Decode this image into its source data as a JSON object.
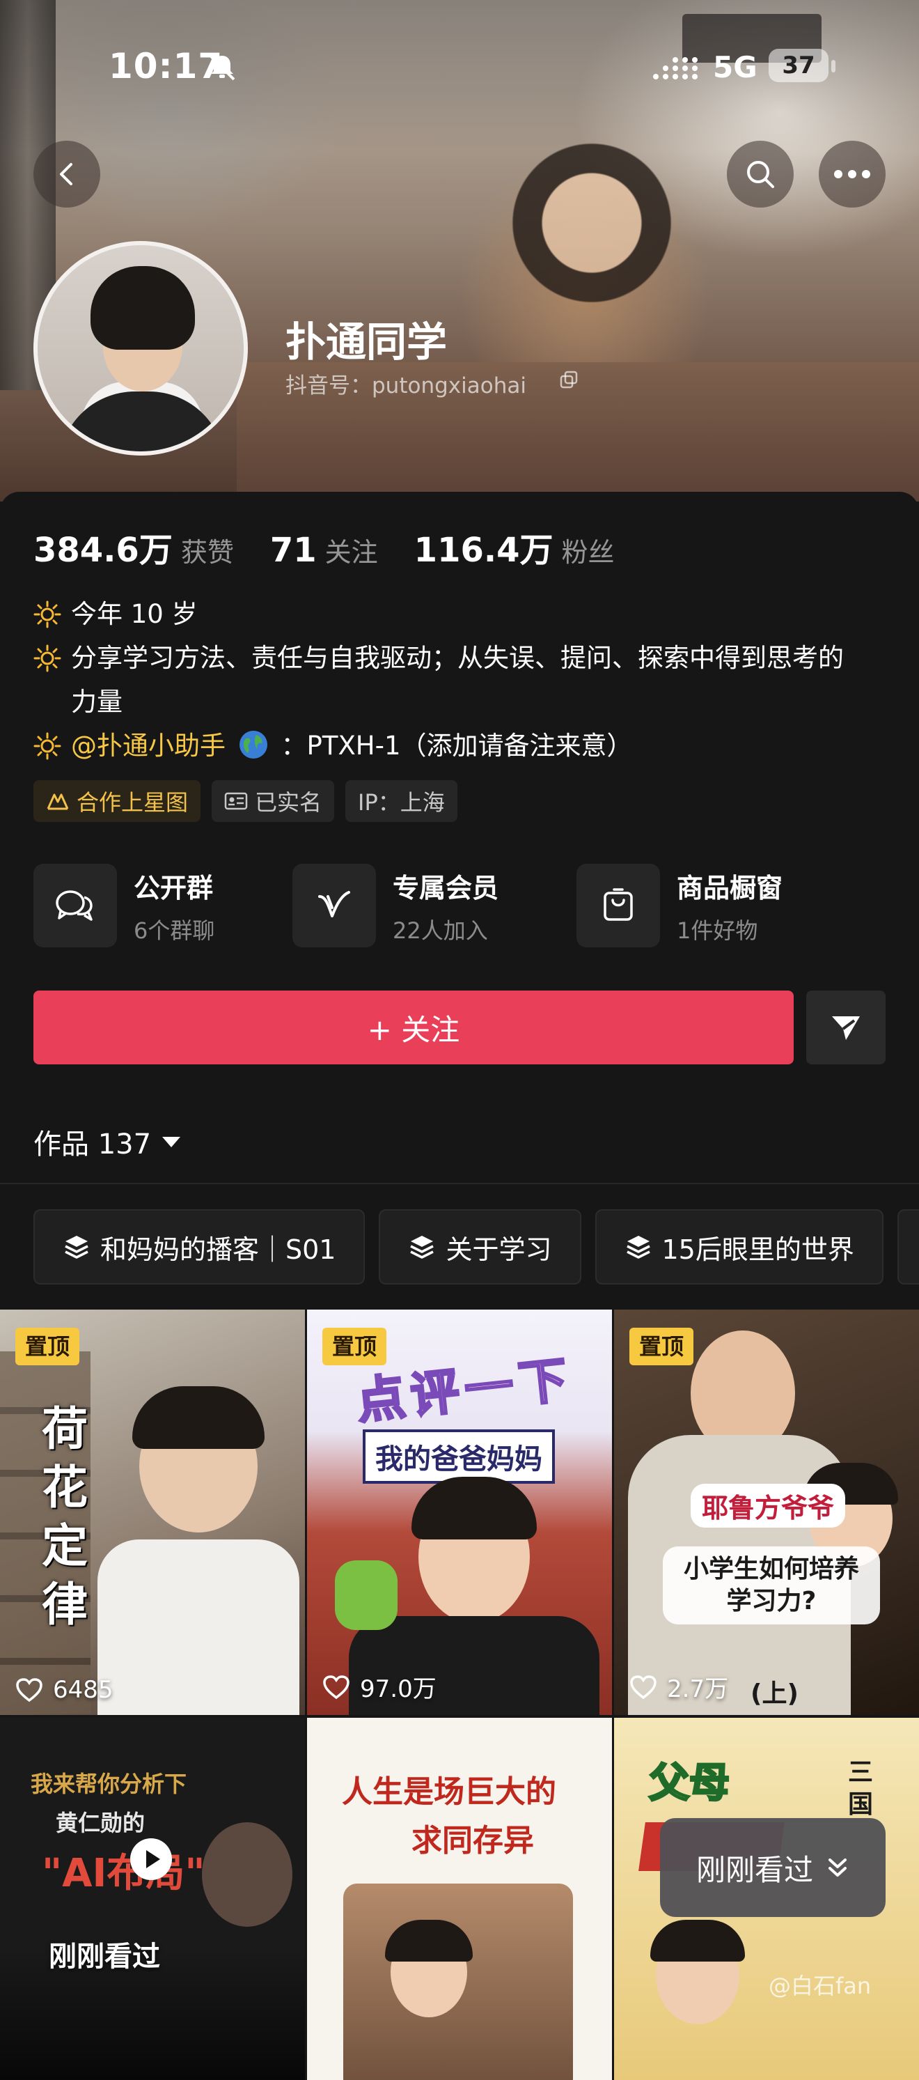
{
  "status_bar": {
    "time": "10:17",
    "network": "5G",
    "battery": "37"
  },
  "profile": {
    "name": "扑通同学",
    "douyin_id": "抖音号：putongxiaohai",
    "stats": [
      {
        "value": "384.6万",
        "label": "获赞"
      },
      {
        "value": "71",
        "label": "关注"
      },
      {
        "value": "116.4万",
        "label": "粉丝"
      }
    ],
    "bio": {
      "line1": "今年 10 岁",
      "line2": "分享学习方法、责任与自我驱动；从失误、提问、探索中得到思考的力量",
      "line3_mention": "@扑通小助手",
      "line3_rest": "：PTXH-1（添加请备注来意）"
    },
    "tags": [
      "合作上星图",
      "已实名",
      "IP：上海"
    ]
  },
  "features": [
    {
      "title": "公开群",
      "sub": "6个群聊",
      "icon": "group-chat-icon"
    },
    {
      "title": "专属会员",
      "sub": "22人加入",
      "icon": "vip-icon"
    },
    {
      "title": "商品橱窗",
      "sub": "1件好物",
      "icon": "shop-bag-icon"
    }
  ],
  "actions": {
    "follow": "+ 关注"
  },
  "works": {
    "label": "作品 137"
  },
  "collections": [
    "和妈妈的播客｜S01",
    "关于学习",
    "15后眼里的世界"
  ],
  "videos": [
    {
      "pinned": "置顶",
      "likes": "6485",
      "title": "荷花定律"
    },
    {
      "pinned": "置顶",
      "likes": "97.0万",
      "title": "点评一下",
      "subtitle": "我的爸爸妈妈"
    },
    {
      "pinned": "置顶",
      "likes": "2.7万",
      "title": "耶鲁方爷爷",
      "subtitle": "小学生如何培养学习力?",
      "suffix": "(上)"
    },
    {
      "title": "我来帮你分析下",
      "subtitle": "黄仁勋的",
      "highlight": "\"AI布局\"",
      "badge": "刚刚看过"
    },
    {
      "title": "人生是场巨大的",
      "subtitle": "求同存异"
    },
    {
      "title": "父母",
      "side": "三国"
    }
  ],
  "floating": {
    "just_watched": "刚刚看过"
  },
  "watermark": "@白石fan",
  "colors": {
    "follow": "#ea3f58",
    "pinned": "#f6c941",
    "mention": "#f7c746",
    "background": "#161616"
  }
}
